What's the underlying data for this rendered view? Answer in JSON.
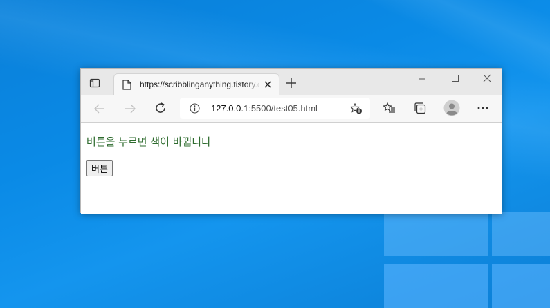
{
  "browser": {
    "tab": {
      "title": "https://scribblinganything.tistory.com"
    },
    "address": {
      "host": "127.0.0.1",
      "rest": ":5500/test05.html"
    }
  },
  "page": {
    "text": "버튼을 누르면 색이 바뀝니다",
    "text_color": "#2e6b2e",
    "button_label": "버튼"
  },
  "icons": {
    "tab_actions": "tab-actions-icon",
    "page": "page-icon",
    "close_tab": "close-icon",
    "new_tab": "plus-icon",
    "back": "arrow-left-icon",
    "forward": "arrow-right-icon",
    "reload": "reload-icon",
    "info": "info-icon",
    "add_favorite": "star-plus-icon",
    "favorites": "favorites-icon",
    "collections": "collections-icon",
    "profile": "profile-icon",
    "more": "more-icon"
  }
}
